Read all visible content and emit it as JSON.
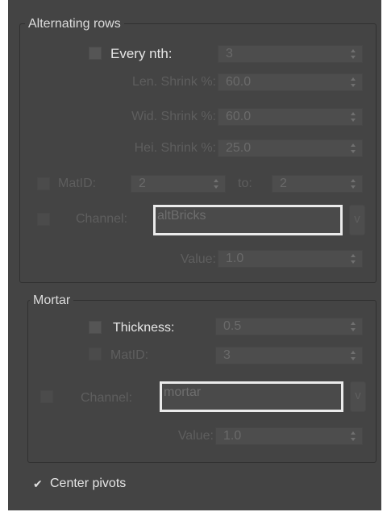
{
  "alternating_rows": {
    "title": "Alternating rows",
    "every_nth": {
      "label": "Every nth:",
      "value": "3",
      "checked": false
    },
    "len_shrink": {
      "label": "Len. Shrink %:",
      "value": "60.0"
    },
    "wid_shrink": {
      "label": "Wid. Shrink %:",
      "value": "60.0"
    },
    "hei_shrink": {
      "label": "Hei. Shrink %:",
      "value": "25.0"
    },
    "matid": {
      "label": "MatID:",
      "value": "2",
      "to_label": "to:",
      "to_value": "2",
      "checked": false
    },
    "channel": {
      "label": "Channel:",
      "value": "altBricks",
      "button": "v",
      "checked": false
    },
    "value": {
      "label": "Value:",
      "value": "1.0"
    }
  },
  "mortar": {
    "title": "Mortar",
    "thickness": {
      "label": "Thickness:",
      "value": "0.5",
      "checked": false
    },
    "matid": {
      "label": "MatID:",
      "value": "3",
      "checked": false
    },
    "channel": {
      "label": "Channel:",
      "value": "mortar",
      "button": "v",
      "checked": false
    },
    "value": {
      "label": "Value:",
      "value": "1.0"
    }
  },
  "center_pivots": {
    "label": "Center pivots",
    "checked": true
  },
  "colors": {
    "panel_bg": "#444444",
    "enabled_text": "#e6e6e6",
    "disabled_text": "#5e5e5e",
    "textbox_border": "#ebebeb"
  }
}
